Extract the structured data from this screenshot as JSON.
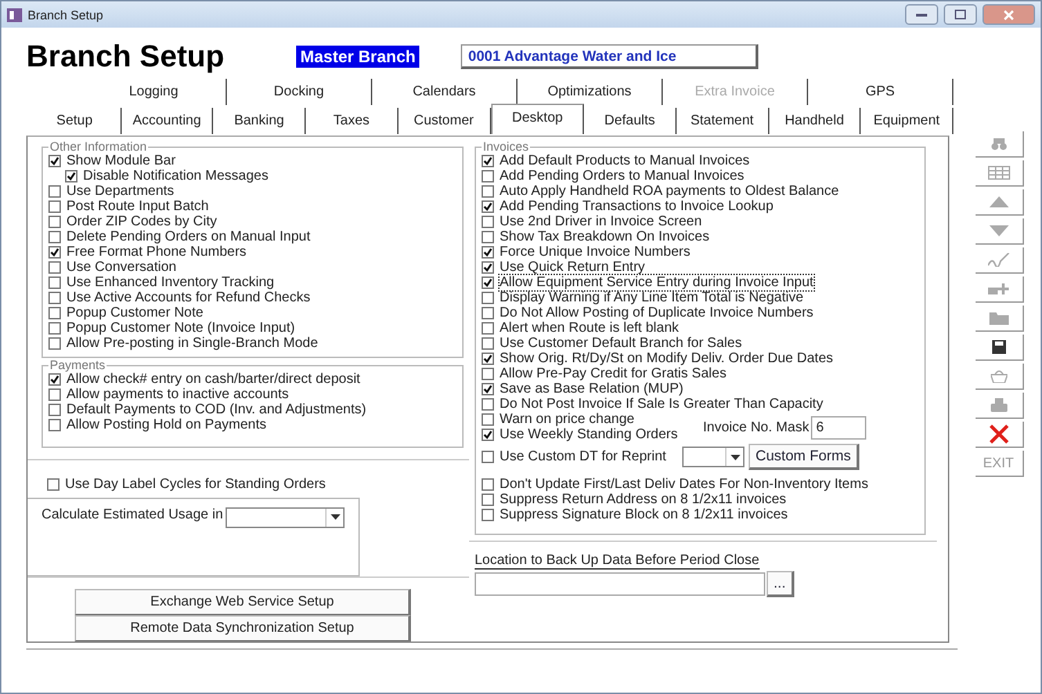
{
  "window": {
    "title": "Branch Setup"
  },
  "header": {
    "title": "Branch Setup",
    "branch_label": "Master Branch",
    "branch_value": "0001  Advantage Water and Ice"
  },
  "tab_rows": [
    [
      {
        "label": "Logging",
        "selected": false,
        "disabled": false
      },
      {
        "label": "Docking",
        "selected": false,
        "disabled": false
      },
      {
        "label": "Calendars",
        "selected": false,
        "disabled": false
      },
      {
        "label": "Optimizations",
        "selected": false,
        "disabled": false
      },
      {
        "label": "Extra Invoice",
        "selected": false,
        "disabled": true
      },
      {
        "label": "GPS",
        "selected": false,
        "disabled": false
      }
    ],
    [
      {
        "label": "Setup",
        "selected": false,
        "disabled": false
      },
      {
        "label": "Accounting",
        "selected": false,
        "disabled": false
      },
      {
        "label": "Banking",
        "selected": false,
        "disabled": false
      },
      {
        "label": "Taxes",
        "selected": false,
        "disabled": false
      },
      {
        "label": "Customer",
        "selected": false,
        "disabled": false
      },
      {
        "label": "Desktop",
        "selected": true,
        "disabled": false
      },
      {
        "label": "Defaults",
        "selected": false,
        "disabled": false
      },
      {
        "label": "Statement",
        "selected": false,
        "disabled": false
      },
      {
        "label": "Handheld",
        "selected": false,
        "disabled": false
      },
      {
        "label": "Equipment",
        "selected": false,
        "disabled": false
      }
    ]
  ],
  "other_information": {
    "title": "Other Information",
    "items": [
      {
        "label": "Show Module Bar",
        "checked": true,
        "children": [
          {
            "label": "Disable Notification Messages",
            "checked": true
          }
        ]
      },
      {
        "label": "Use Departments",
        "checked": false
      },
      {
        "label": "Post Route Input Batch",
        "checked": false
      },
      {
        "label": "Order ZIP Codes by City",
        "checked": false
      },
      {
        "label": "Delete Pending Orders on Manual Input",
        "checked": false
      },
      {
        "label": "Free Format Phone Numbers",
        "checked": true
      },
      {
        "label": "Use Conversation",
        "checked": false
      },
      {
        "label": "Use Enhanced Inventory Tracking",
        "checked": false
      },
      {
        "label": "Use Active Accounts for Refund Checks",
        "checked": false
      },
      {
        "label": "Popup Customer Note",
        "checked": false
      },
      {
        "label": "Popup Customer Note (Invoice Input)",
        "checked": false
      },
      {
        "label": "Allow Pre-posting in Single-Branch Mode",
        "checked": false
      }
    ]
  },
  "payments": {
    "title": "Payments",
    "items": [
      {
        "label": "Allow check# entry on cash/barter/direct deposit",
        "checked": true
      },
      {
        "label": "Allow payments to inactive accounts",
        "checked": false
      },
      {
        "label": "Default Payments to COD (Inv. and Adjustments)",
        "checked": false
      },
      {
        "label": "Allow Posting Hold on Payments",
        "checked": false
      }
    ]
  },
  "day_label_cycles": {
    "label": "Use Day Label Cycles for Standing Orders",
    "checked": false
  },
  "estimated_usage": {
    "label": "Calculate Estimated Usage in"
  },
  "setup_buttons": [
    "Exchange Web Service Setup",
    "Remote Data Synchronization Setup"
  ],
  "invoices": {
    "title": "Invoices",
    "items": [
      {
        "label": "Add Default Products to Manual Invoices",
        "checked": true,
        "focused": false
      },
      {
        "label": "Add Pending Orders to Manual Invoices",
        "checked": false,
        "focused": false
      },
      {
        "label": "Auto Apply Handheld ROA payments to Oldest Balance",
        "checked": false,
        "focused": false
      },
      {
        "label": "Add Pending Transactions to Invoice Lookup",
        "checked": true,
        "focused": false
      },
      {
        "label": "Use 2nd Driver in Invoice Screen",
        "checked": false,
        "focused": false
      },
      {
        "label": "Show Tax Breakdown On Invoices",
        "checked": false,
        "focused": false
      },
      {
        "label": "Force Unique Invoice Numbers",
        "checked": true,
        "focused": false
      },
      {
        "label": "Use Quick Return Entry",
        "checked": true,
        "focused": false
      },
      {
        "label": "Allow Equipment  Service Entry during Invoice Input",
        "checked": true,
        "focused": true
      },
      {
        "label": "Display Warning if Any Line Item Total is Negative",
        "checked": false,
        "focused": false
      },
      {
        "label": "Do Not Allow Posting of Duplicate Invoice Numbers",
        "checked": false,
        "focused": false
      },
      {
        "label": "Alert when Route is left blank",
        "checked": false,
        "focused": false
      },
      {
        "label": "Use Customer Default Branch for Sales",
        "checked": false,
        "focused": false
      },
      {
        "label": "Show Orig. Rt/Dy/St on Modify Deliv. Order Due Dates",
        "checked": true,
        "focused": false
      },
      {
        "label": "Allow Pre-Pay Credit for Gratis Sales",
        "checked": false,
        "focused": false
      },
      {
        "label": "Save as Base Relation (MUP)",
        "checked": true,
        "focused": false
      },
      {
        "label": "Do Not Post Invoice If Sale Is Greater Than Capacity",
        "checked": false,
        "focused": false
      }
    ],
    "warn_price": {
      "label": "Warn on price change",
      "checked": false
    },
    "weekly_orders": {
      "label": "Use Weekly Standing Orders",
      "checked": true
    },
    "custom_dt": {
      "label": "Use Custom DT for Reprint",
      "checked": false
    },
    "mask": {
      "label": "Invoice No. Mask",
      "value": "6"
    },
    "custom_forms_button": "Custom Forms",
    "more_items": [
      {
        "label": "Don't Update First/Last Deliv Dates For Non-Inventory Items",
        "checked": false
      },
      {
        "label": "Suppress Return Address on 8 1/2x11 invoices",
        "checked": false
      },
      {
        "label": "Suppress Signature Block on 8 1/2x11 invoices",
        "checked": false
      }
    ]
  },
  "backup": {
    "label": "Location to Back Up Data Before Period Close",
    "browse": "..."
  },
  "toolbar": [
    {
      "kind": "search",
      "disabled": true
    },
    {
      "kind": "grid",
      "disabled": true
    },
    {
      "kind": "up",
      "disabled": true
    },
    {
      "kind": "down",
      "disabled": true
    },
    {
      "kind": "sign",
      "disabled": true
    },
    {
      "kind": "add",
      "disabled": true
    },
    {
      "kind": "folder",
      "disabled": true
    },
    {
      "kind": "save",
      "disabled": false
    },
    {
      "kind": "basket",
      "disabled": true
    },
    {
      "kind": "print",
      "disabled": true
    },
    {
      "kind": "close",
      "disabled": false
    },
    {
      "kind": "exit",
      "label": "EXIT",
      "disabled": true
    }
  ]
}
